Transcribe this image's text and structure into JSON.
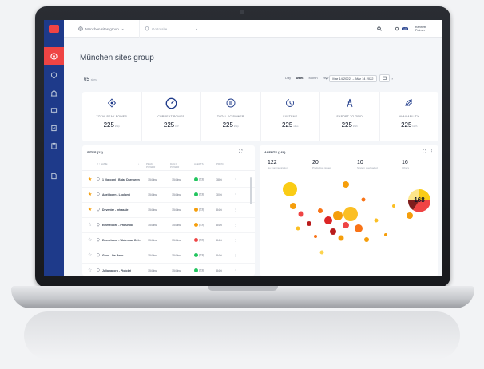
{
  "topbar": {
    "group_selector": "München sites group",
    "site_selector": "Go to site",
    "notifications_count": "10",
    "user_name": "Kenneth Palmer"
  },
  "page": {
    "title": "München sites group",
    "sites_count": "65",
    "sites_unit": "sites"
  },
  "range": {
    "tabs": [
      "Day",
      "Week",
      "Month",
      "Year"
    ],
    "selected": "Week",
    "start": "Mar 14 2022",
    "end": "Mar 14 2022"
  },
  "kpis": [
    {
      "icon": "power-icon",
      "label": "TOTAL PEAK POWER",
      "value": "225",
      "unit": "kWp"
    },
    {
      "icon": "gauge-icon",
      "label": "CURRENT POWER",
      "value": "225",
      "unit": "kW"
    },
    {
      "icon": "dc-power-icon",
      "label": "TOTAL DC POWER",
      "value": "225",
      "unit": "kWp"
    },
    {
      "icon": "system-icon",
      "label": "SYSTEMS",
      "value": "225",
      "unit": "sites"
    },
    {
      "icon": "grid-tower-icon",
      "label": "EXPORT TO GRID",
      "value": "225",
      "unit": "kWh"
    },
    {
      "icon": "signal-icon",
      "label": "AVAILABILITY",
      "value": "225",
      "unit": "kWh"
    }
  ],
  "sites": {
    "title": "SITES (12)",
    "columns": [
      "# ↑ NAME",
      "PEAK POWER",
      "DAILY POWER",
      "ALERTS",
      "PR (%)"
    ],
    "rows": [
      {
        "starred": true,
        "name": "1 Viaccani - Batar Daerowen",
        "peak": "154 kw",
        "daily": "154 kw",
        "status": "#22c55e",
        "alerts": "(23)",
        "pr": "38%"
      },
      {
        "starred": true,
        "name": "Apeldoorn - Loolbeni",
        "peak": "154 kw",
        "daily": "154 kw",
        "status": "#22c55e",
        "alerts": "(23)",
        "pr": "30%"
      },
      {
        "starred": true,
        "name": "Deventer - Intrasale",
        "peak": "154 kw",
        "daily": "154 kw",
        "status": "#f59e0b",
        "alerts": "(23)",
        "pr": "84%"
      },
      {
        "starred": false,
        "name": "Emmeloord - Profundo",
        "peak": "154 kw",
        "daily": "154 kw",
        "status": "#f59e0b",
        "alerts": "(23)",
        "pr": "84%"
      },
      {
        "starred": false,
        "name": "Emmeloord - Waterman Del...",
        "peak": "154 kw",
        "daily": "154 kw",
        "status": "#ef4444",
        "alerts": "(23)",
        "pr": "84%"
      },
      {
        "starred": false,
        "name": "Gouo - De Beun",
        "peak": "154 kw",
        "daily": "154 kw",
        "status": "#22c55e",
        "alerts": "(23)",
        "pr": "84%"
      },
      {
        "starred": false,
        "name": "Julianadorp - Plotobri",
        "peak": "154 kw",
        "daily": "154 kw",
        "status": "#22c55e",
        "alerts": "(23)",
        "pr": "84%"
      }
    ]
  },
  "alerts": {
    "title": "ALERTS (168)",
    "stats": [
      {
        "value": "122",
        "label": "No Communication"
      },
      {
        "value": "20",
        "label": "Production issues"
      },
      {
        "value": "10",
        "label": "System overloaded"
      },
      {
        "value": "16",
        "label": "Others"
      }
    ],
    "donut_total": "168"
  },
  "colors": {
    "sidebar": "#1e3a8a",
    "accent": "#ef4444",
    "orange": "#f59e0b",
    "green": "#22c55e"
  }
}
